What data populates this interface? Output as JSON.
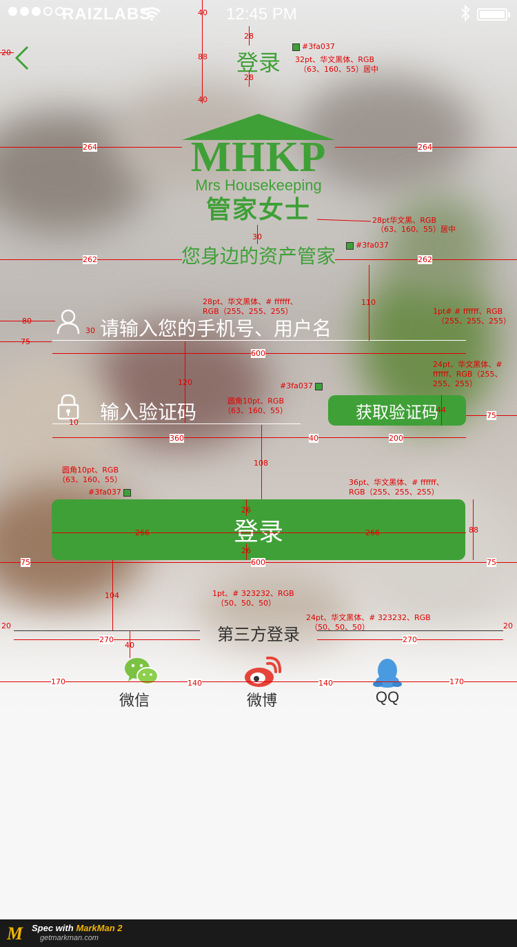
{
  "status_bar": {
    "carrier": "RAIZLABS",
    "time": "12:45 PM"
  },
  "nav": {
    "title": "登录"
  },
  "logo": {
    "mhkp": "MHKP",
    "subtitle": "Mrs Housekeeping",
    "cn_name": "管家女士"
  },
  "slogan": "您身边的资产管家",
  "form": {
    "account_placeholder": "请输入您的手机号、用户名",
    "code_placeholder": "输入验证码",
    "get_code_label": "获取验证码",
    "login_label": "登录"
  },
  "third_party": {
    "title": "第三方登录",
    "items": [
      {
        "label": "微信",
        "icon": "wechat-icon"
      },
      {
        "label": "微博",
        "icon": "weibo-icon"
      },
      {
        "label": "QQ",
        "icon": "qq-icon"
      }
    ]
  },
  "colors": {
    "brand_green": "#3fa037",
    "text_dark": "#323232",
    "white": "#ffffff"
  },
  "annotations": {
    "swatch_title": "#3fa037",
    "title_spec_1": "32pt、华文黑体、RGB",
    "title_spec_2": "（63、160、55）居中",
    "logo_spec_1": "28pt华文黑、RGB",
    "logo_spec_2": "（63、160、55）居中",
    "swatch_slogan": "#3fa037",
    "input_text_spec_1": "28pt、华文黑体、# ffffff、",
    "input_text_spec_2": "RGB（255、255、255）",
    "line_spec_1": "1pt# # ffffff、RGB",
    "line_spec_2": "（255、255、255）",
    "btn_text_spec_1": "24pt、华文黑体、#",
    "btn_text_spec_2": "ffffff、RGB（255、",
    "btn_text_spec_3": "255、255）",
    "swatch_code_btn": "#3fa037",
    "code_btn_spec_1": "圆角10pt、RGB",
    "code_btn_spec_2": "（63、160、55）",
    "login_btn_spec_1": "圆角10pt、RGB",
    "login_btn_spec_2": "（63、160、55）",
    "swatch_login": "#3fa037",
    "login_text_spec_1": "36pt、华文黑体、# ffffff、",
    "login_text_spec_2": "RGB（255、255、255）",
    "tp_line_spec_1": "1pt、# 323232、RGB",
    "tp_line_spec_2": "（50、50、50）",
    "tp_text_spec_1": "24pt、华文黑体、# 323232、RGB",
    "tp_text_spec_2": "（50、50、50）",
    "d_40a": "40",
    "d_28a": "28",
    "d_88a": "88",
    "d_28b": "28",
    "d_40b": "40",
    "d_20a": "20",
    "d_264a": "264",
    "d_264b": "264",
    "d_30a": "30",
    "d_262a": "262",
    "d_262b": "262",
    "d_110": "110",
    "d_80": "80",
    "d_30b": "30",
    "d_75a": "75",
    "d_600a": "600",
    "d_120": "120",
    "d_10": "10",
    "d_44": "44",
    "d_75b": "75",
    "d_360": "360",
    "d_40c": "40",
    "d_200": "200",
    "d_108": "108",
    "d_26a": "26",
    "d_266a": "266",
    "d_266b": "266",
    "d_26b": "26",
    "d_88b": "88",
    "d_75c": "75",
    "d_600b": "600",
    "d_75d": "75",
    "d_104": "104",
    "d_20b": "20",
    "d_270a": "270",
    "d_270b": "270",
    "d_20c": "20",
    "d_40d": "40",
    "d_170a": "170",
    "d_140a": "140",
    "d_140b": "140",
    "d_170b": "170"
  },
  "footer": {
    "mark": "M",
    "spec_label": "Spec with",
    "app_name": "MarkMan 2",
    "site": "getmarkman.com"
  }
}
